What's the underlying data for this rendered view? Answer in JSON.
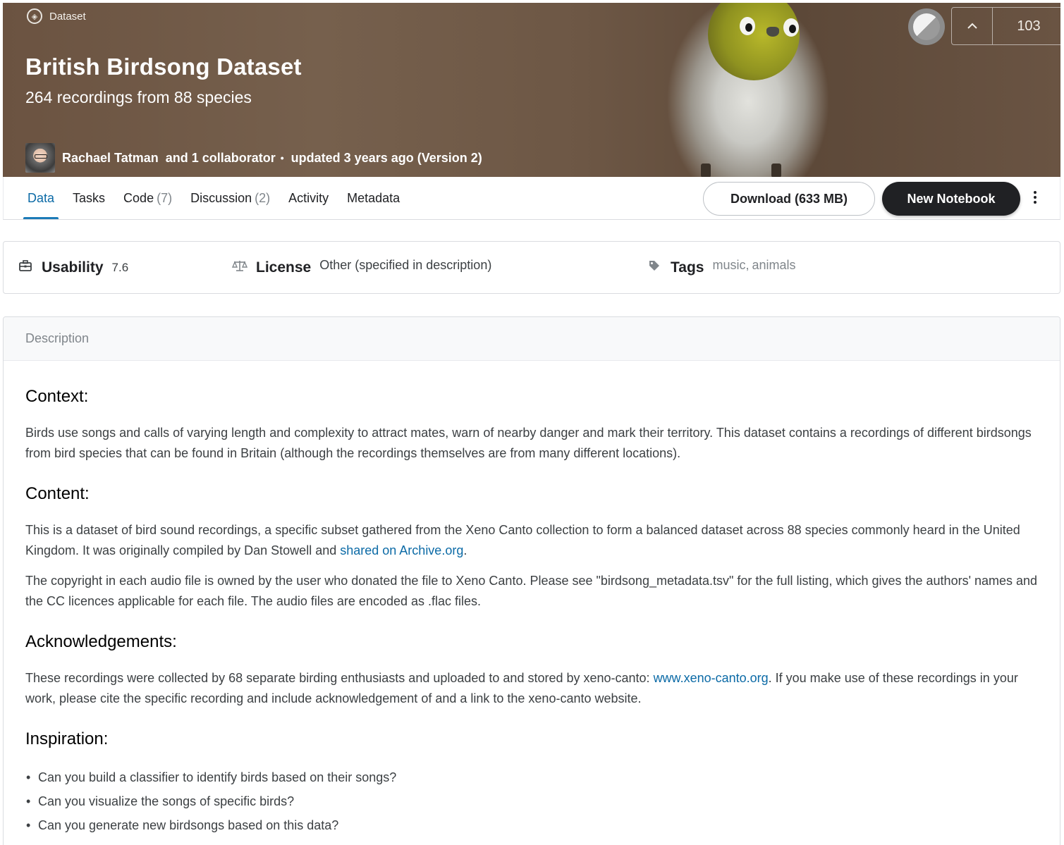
{
  "header": {
    "kicker": "Dataset",
    "title": "British Birdsong Dataset",
    "subtitle": "264 recordings from 88 species",
    "owner": "Rachael Tatman",
    "collaborators": "and 1 collaborator",
    "separator": "•",
    "updated": "updated 3 years ago (Version 2)",
    "votes": "103",
    "upvote_icon": "chevron-up-icon",
    "kicker_icon": "dataset-icon"
  },
  "tabs": [
    {
      "label": "Data",
      "count": ""
    },
    {
      "label": "Tasks",
      "count": ""
    },
    {
      "label": "Code",
      "count": "(7)"
    },
    {
      "label": "Discussion",
      "count": "(2)"
    },
    {
      "label": "Activity",
      "count": ""
    },
    {
      "label": "Metadata",
      "count": ""
    }
  ],
  "actions": {
    "download_label": "Download (633 MB)",
    "new_notebook_label": "New Notebook"
  },
  "meta": {
    "usability_label": "Usability",
    "usability_value": "7.6",
    "license_label": "License",
    "license_value": "Other (specified in description)",
    "tags_label": "Tags",
    "tags": [
      "music",
      "animals"
    ]
  },
  "description": {
    "header": "Description",
    "context_heading": "Context:",
    "context_text": "Birds use songs and calls of varying length and complexity to attract mates, warn of nearby danger and mark their territory. This dataset contains a recordings of different birdsongs from bird species that can be found in Britain (although the recordings themselves are from many different locations).",
    "content_heading": "Content:",
    "content_text_1": "This is a dataset of bird sound recordings, a specific subset gathered from the Xeno Canto collection to form a balanced dataset across 88 species commonly heard in the United Kingdom. It was originally compiled by Dan Stowell and ",
    "content_link": "shared on Archive.org",
    "content_text_1_end": ".",
    "content_text_2": "The copyright in each audio file is owned by the user who donated the file to Xeno Canto. Please see \"birdsong_metadata.tsv\" for the full listing, which gives the authors' names and the CC licences applicable for each file. The audio files are encoded as .flac files.",
    "ack_heading": "Acknowledgements:",
    "ack_text_1": "These recordings were collected by 68 separate birding enthusiasts and uploaded to and stored by xeno-canto: ",
    "ack_link": "www.xeno-canto.org",
    "ack_text_2": ". If you make use of these recordings in your work, please cite the specific recording and include acknowledgement of and a link to the xeno-canto website.",
    "inspiration_heading": "Inspiration:",
    "inspiration_items": [
      "Can you build a classifier to identify birds based on their songs?",
      "Can you visualize the songs of specific birds?",
      "Can you generate new birdsongs based on this data?"
    ]
  }
}
